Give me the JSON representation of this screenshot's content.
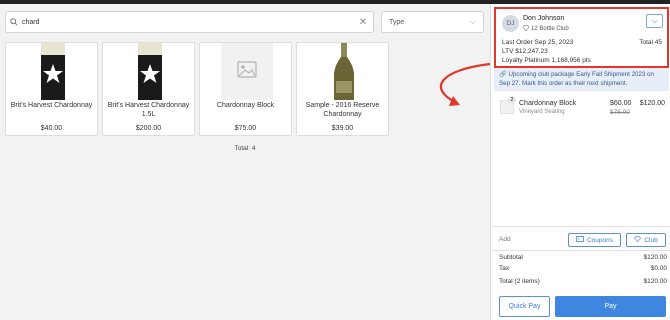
{
  "search": {
    "value": "chard"
  },
  "type_filter": {
    "label": "Type"
  },
  "products": [
    {
      "name": "Brit's Harvest Chardonnay",
      "price": "$40.00",
      "image": "wine-bottle-black-label"
    },
    {
      "name": "Brit's Harvest Chardonnay 1.5L",
      "price": "$200.00",
      "image": "wine-bottle-black-label"
    },
    {
      "name": "Chardonnay Block",
      "price": "$75.00",
      "image": "placeholder-image"
    },
    {
      "name": "Sample - 2016 Reserve Chardonnay",
      "price": "$39.00",
      "image": "wine-bottle-green"
    }
  ],
  "results_total": "Total: 4",
  "customer": {
    "initials": "DJ",
    "name": "Don Johnson",
    "club": "12 Bottle Club",
    "last_order": "Last Order Sep 25, 2023",
    "total": "Total 45",
    "ltv": "LTV $12,247.23",
    "loyalty": "Loyalty Platinum 1,168,956 pts"
  },
  "notice": "Upcoming club package Early Fall Shipment 2023 on Sep 27. Mark this order as their next shipment.",
  "cart": {
    "items": [
      {
        "qty": "2",
        "name": "Chardonnay Block",
        "sub": "Vineyard Seating",
        "unit": "$60.00",
        "original": "$75.00",
        "extended": "$120.00"
      }
    ],
    "add_label": "Add",
    "coupons_label": "Coupons",
    "club_label": "Club",
    "subtotal_label": "Subtotal",
    "subtotal": "$120.00",
    "tax_label": "Tax",
    "tax": "$0.00",
    "total_label": "Total (2 items)",
    "total": "$120.00",
    "quick_pay": "Quick Pay",
    "pay": "Pay"
  },
  "colors": {
    "accent": "#3f86e0",
    "highlight": "#e0362c",
    "notice_bg": "#e7eef8"
  }
}
